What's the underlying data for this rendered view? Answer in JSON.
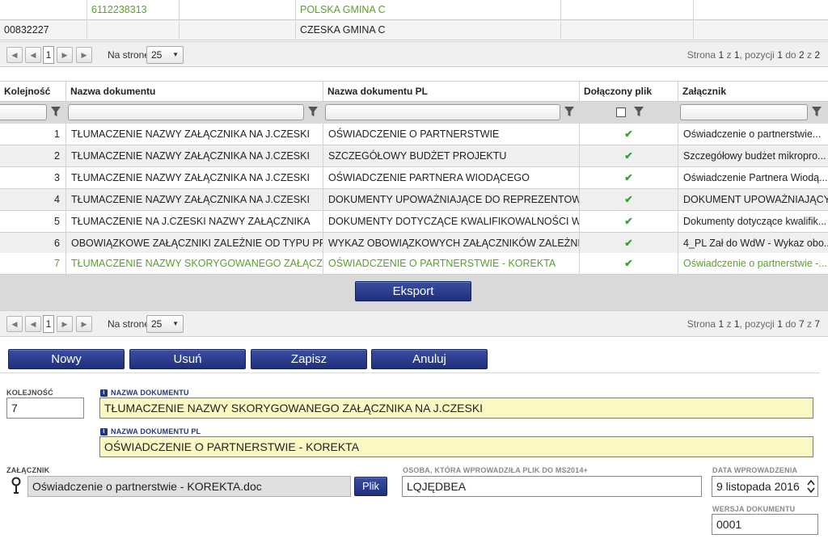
{
  "top_table": {
    "rows": [
      {
        "col_a": "",
        "col_b": "6112238313",
        "col_c": "",
        "col_d": "POLSKA GMINA C",
        "col_e": "",
        "col_f": "",
        "green": true
      },
      {
        "col_a": "00832227",
        "col_b": "",
        "col_c": "",
        "col_d": "CZESKA GMINA C",
        "col_e": "",
        "col_f": "",
        "green": false
      }
    ]
  },
  "pager_top": {
    "page": "1",
    "per_page_label": "Na stronę",
    "per_page": "25",
    "info": {
      "p1": "Strona",
      "v1": "1",
      "p2": "z",
      "v2": "1",
      "p3": ", pozycji",
      "v3": "1",
      "p4": "do",
      "v4": "2",
      "p5": "z",
      "v5": "2"
    }
  },
  "grid": {
    "headers": [
      "Kolejność",
      "Nazwa dokumentu",
      "Nazwa dokumentu PL",
      "Dołączony plik",
      "Załącznik"
    ],
    "rows": [
      {
        "n": "1",
        "name": "TŁUMACZENIE NAZWY ZAŁĄCZNIKA NA J.CZESKI",
        "name_pl": "OŚWIADCZENIE O PARTNERSTWIE",
        "attached": "✔",
        "file": "Oświadczenie o partnerstwie..."
      },
      {
        "n": "2",
        "name": "TŁUMACZENIE NAZWY ZAŁĄCZNIKA NA J.CZESKI",
        "name_pl": "SZCZEGÓŁOWY BUDŻET PROJEKTU",
        "attached": "✔",
        "file": "Szczegółowy budżet mikropro..."
      },
      {
        "n": "3",
        "name": "TŁUMACZENIE NAZWY ZAŁĄCZNIKA NA J.CZESKI",
        "name_pl": "OŚWIADCZENIE PARTNERA WIODĄCEGO",
        "attached": "✔",
        "file": "Oświadczenie Partnera Wiodą..."
      },
      {
        "n": "4",
        "name": "TŁUMACZENIE NAZWY ZAŁĄCZNIKA NA J.CZESKI",
        "name_pl": "DOKUMENTY UPOWAŻNIAJĄCE DO REPREZENTOWANI...",
        "attached": "✔",
        "file": "DOKUMENT UPOWAŻNIAJĄCY..."
      },
      {
        "n": "5",
        "name": "TŁUMACZENIE NA J.CZESKI NAZWY ZAŁĄCZNIKA",
        "name_pl": "DOKUMENTY DOTYCZĄCE KWALIFIKOWALNOŚCI WNIO...",
        "attached": "✔",
        "file": "Dokumenty dotyczące kwalifik..."
      },
      {
        "n": "6",
        "name": "OBOWIĄZKOWE ZAŁĄCZNIKI ZALEŻNIE OD TYPU PROJE...",
        "name_pl": "WYKAZ OBOWIĄZKOWYCH ZAŁĄCZNIKÓW ZALEŻNIE OD...",
        "attached": "✔",
        "file": "4_PL Zał do WdW - Wykaz obo..."
      },
      {
        "n": "7",
        "name": "TŁUMACZENIE NAZWY SKORYGOWANEGO ZAŁĄCZNIKA...",
        "name_pl": "OŚWIADCZENIE O PARTNERSTWIE - KOREKTA",
        "attached": "✔",
        "file": "Oświadczenie o partnerstwie -..."
      }
    ],
    "export_label": "Eksport"
  },
  "pager_bottom": {
    "page": "1",
    "per_page_label": "Na stronę",
    "per_page": "25",
    "info": {
      "p1": "Strona",
      "v1": "1",
      "p2": "z",
      "v2": "1",
      "p3": ", pozycji",
      "v3": "1",
      "p4": "do",
      "v4": "7",
      "p5": "z",
      "v5": "7"
    }
  },
  "actions": {
    "new": "Nowy",
    "delete": "Usuń",
    "save": "Zapisz",
    "cancel": "Anuluj"
  },
  "form": {
    "order_label": "KOLEJNOŚĆ",
    "order_value": "7",
    "name_label": "NAZWA DOKUMENTU",
    "name_value": "TŁUMACZENIE NAZWY SKORYGOWANEGO ZAŁĄCZNIKA NA J.CZESKI",
    "name_pl_label": "NAZWA DOKUMENTU PL",
    "name_pl_value": "OŚWIADCZENIE O PARTNERSTWIE - KOREKTA",
    "attachment_label": "ZAŁĄCZNIK",
    "attachment_value": "Oświadczenie o partnerstwie - KOREKTA.doc",
    "file_button": "Plik",
    "uploader_label": "OSOBA, KTÓRA WPROWADZIŁA PLIK DO MS2014+",
    "uploader_value": "LQJĘDBEA",
    "date_label": "DATA WPROWADZENIA",
    "date_value": "9 listopada 2016",
    "version_label": "WERSJA DOKUMENTU",
    "version_value": "0001",
    "info_icon_text": "i"
  },
  "colors": {
    "green_text": "#5aa02c",
    "button_blue": "#26378a",
    "highlight_yellow": "#fcf8c4",
    "check_green": "#3aa13a"
  }
}
